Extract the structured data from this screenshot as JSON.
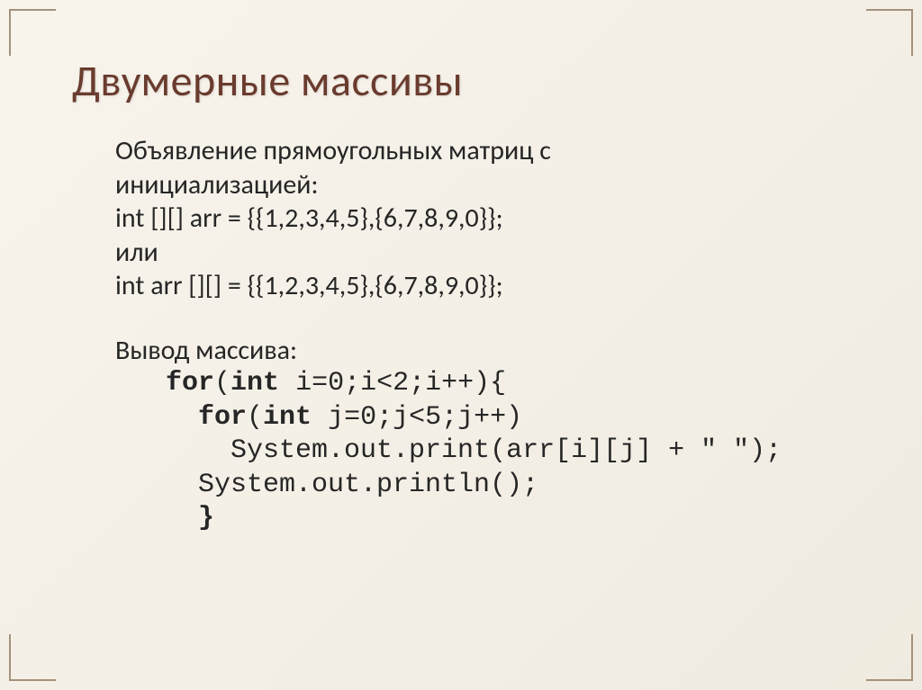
{
  "slide": {
    "title": "Двумерные массивы",
    "intro_line1": "Объявление прямоугольных матриц с",
    "intro_line2": "инициализацией:",
    "decl1": "int [][] arr = {{1,2,3,4,5},{6,7,8,9,0}};",
    "or_word": "или",
    "decl2": "int arr [][] = {{1,2,3,4,5},{6,7,8,9,0}};",
    "output_heading": "Вывод массива:",
    "code": {
      "for_kw": "for",
      "int_kw": "int",
      "outer_start_a": "(",
      "outer_start_b": " i=0;i<2;i++){",
      "inner_prefix": "    ",
      "inner_start_a": "(",
      "inner_start_b": " j=0;j<5;j++)",
      "print_line": "      System.out.print(arr[i][j] + \" \");",
      "println_line": "    System.out.println();",
      "close_line": "    }"
    }
  }
}
